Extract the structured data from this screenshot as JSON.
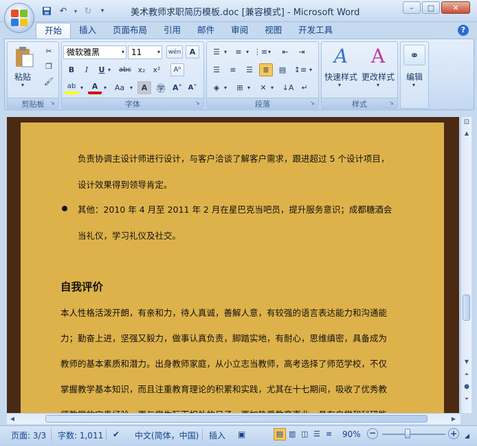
{
  "window": {
    "title": "美术教师求职简历模板.doc [兼容模式] - Microsoft Word",
    "minimize": "–",
    "maximize": "□",
    "close": "✕"
  },
  "qat": {
    "save_icon": "save-icon",
    "undo_icon": "undo-icon",
    "redo_icon": "redo-icon",
    "customize_icon": "customize-qat-icon"
  },
  "tabs": [
    {
      "label": "开始",
      "active": true
    },
    {
      "label": "插入"
    },
    {
      "label": "页面布局"
    },
    {
      "label": "引用"
    },
    {
      "label": "邮件"
    },
    {
      "label": "审阅"
    },
    {
      "label": "视图"
    },
    {
      "label": "开发工具"
    }
  ],
  "help": "?",
  "ribbon": {
    "clipboard": {
      "label": "剪贴板",
      "paste": "粘贴"
    },
    "font": {
      "label": "字体",
      "font_name": "微软雅黑",
      "font_size": "11"
    },
    "paragraph": {
      "label": "段落"
    },
    "styles": {
      "label": "样式",
      "quick_styles": "快速样式",
      "change_styles": "更改样式"
    },
    "editing": {
      "label": "编辑"
    }
  },
  "document": {
    "lines": [
      "负责协调主设计师进行设计，与客户洽谈了解客户需求，跟进超过 5 个设计项目，",
      "设计效果得到领导肯定。",
      "其他：2010 年 4 月至 2011 年 2 月在星巴克当吧员，提升服务意识；成都糖酒会",
      "当礼仪，学习礼仪及社交。"
    ],
    "heading": "自我评价",
    "body": [
      "本人性格活泼开朗，有亲和力，待人真诚，善解人意，有较强的语言表达能力和沟通能",
      "力；勤奋上进，坚强又毅力，做事认真负责，脚踏实地，有耐心，思维缜密，具备成为",
      "教师的基本素质和潜力。出身教师家庭，从小立志当教师，高考选择了师范学校，不仅",
      "掌握教学基本知识，而且注重教育理论的积累和实践，尤其在十七期间，吸收了优秀教",
      "师教学的宝贵经验，更与学生际而相处的日子，更加热爱教育事业，具有自学和科研能"
    ]
  },
  "status": {
    "page": "页面: 3/3",
    "words": "字数: 1,011",
    "language": "中文(简体，中国)",
    "mode": "插入",
    "zoom": "90%",
    "zoom_minus": "−",
    "zoom_plus": "+"
  },
  "colors": {
    "page_bg": "#deb24a",
    "doc_bg": "#4a2a12",
    "ribbon": "#cfe0f5",
    "highlight_yellow": "#ffff00",
    "font_red": "#d01010"
  }
}
